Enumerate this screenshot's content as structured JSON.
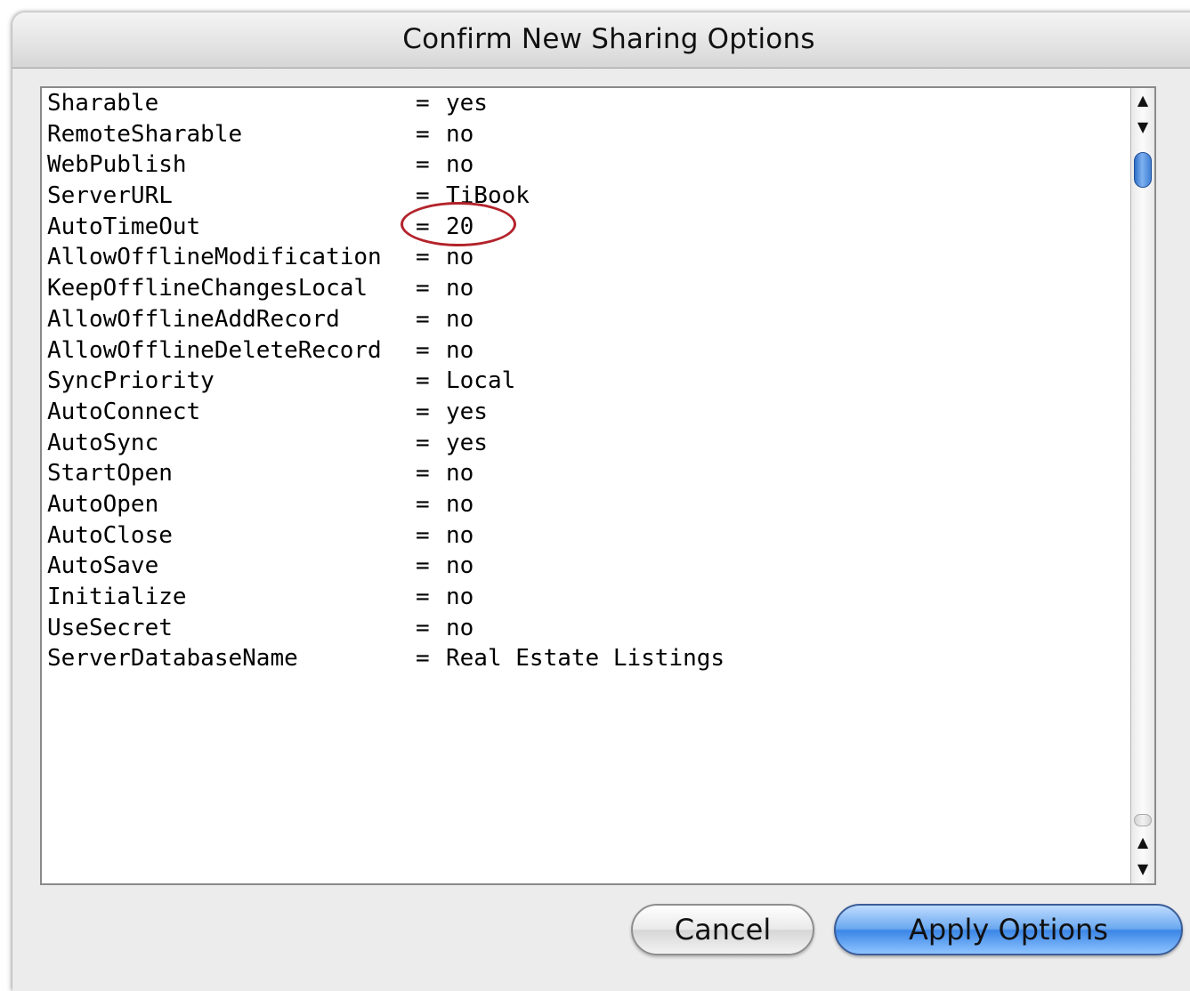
{
  "window": {
    "title": "Confirm New Sharing Options"
  },
  "options": [
    {
      "key": "Sharable",
      "value": "yes"
    },
    {
      "key": "RemoteSharable",
      "value": "no"
    },
    {
      "key": "WebPublish",
      "value": "no"
    },
    {
      "key": "ServerURL",
      "value": "TiBook"
    },
    {
      "key": "AutoTimeOut",
      "value": "20"
    },
    {
      "key": "AllowOfflineModification",
      "value": "no"
    },
    {
      "key": "KeepOfflineChangesLocal",
      "value": "no"
    },
    {
      "key": "AllowOfflineAddRecord",
      "value": "no"
    },
    {
      "key": "AllowOfflineDeleteRecord",
      "value": "no"
    },
    {
      "key": "SyncPriority",
      "value": "Local"
    },
    {
      "key": "AutoConnect",
      "value": "yes"
    },
    {
      "key": "AutoSync",
      "value": "yes"
    },
    {
      "key": "StartOpen",
      "value": "no"
    },
    {
      "key": "AutoOpen",
      "value": "no"
    },
    {
      "key": "AutoClose",
      "value": "no"
    },
    {
      "key": "AutoSave",
      "value": "no"
    },
    {
      "key": "Initialize",
      "value": "no"
    },
    {
      "key": "UseSecret",
      "value": "no"
    },
    {
      "key": "ServerDatabaseName",
      "value": "Real Estate Listings"
    }
  ],
  "separator": "=",
  "scrollbar": {
    "up_arrow": "▲",
    "down_arrow": "▼"
  },
  "buttons": {
    "cancel": "Cancel",
    "apply": "Apply Options"
  },
  "colors": {
    "highlight_circle": "#b3232b",
    "default_button": "#3b86e6"
  }
}
